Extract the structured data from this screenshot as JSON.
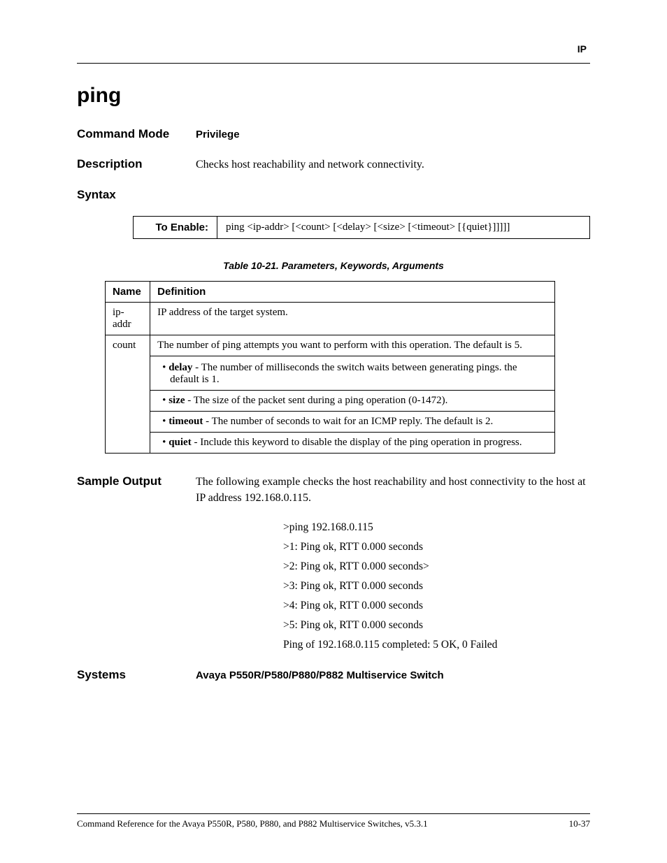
{
  "header": {
    "section": "IP"
  },
  "title": "ping",
  "sections": {
    "command_mode": {
      "label": "Command Mode",
      "value": "Privilege"
    },
    "description": {
      "label": "Description",
      "value": "Checks host reachability and network connectivity."
    },
    "syntax": {
      "label": "Syntax",
      "to_enable_label": "To Enable:",
      "to_enable_value": "ping <ip-addr> [<count> [<delay> [<size> [<timeout> [{quiet}]]]]]"
    },
    "sample_output": {
      "label": "Sample Output",
      "intro": "The following example checks the host reachability and host connectivity to the host at IP address 192.168.0.115.",
      "lines": [
        ">ping 192.168.0.115",
        ">1: Ping ok, RTT 0.000 seconds",
        ">2: Ping ok, RTT 0.000 seconds>",
        ">3: Ping ok, RTT 0.000 seconds",
        ">4: Ping ok, RTT 0.000 seconds",
        ">5: Ping ok, RTT 0.000 seconds",
        "Ping of 192.168.0.115 completed: 5 OK, 0 Failed"
      ]
    },
    "systems": {
      "label": "Systems",
      "value": "Avaya P550R/P580/P880/P882 Multiservice Switch"
    }
  },
  "params_table": {
    "caption": "Table 10-21.  Parameters, Keywords, Arguments",
    "headers": [
      "Name",
      "Definition"
    ],
    "rows": [
      {
        "name": "ip-addr",
        "definition": "IP address of the target system."
      },
      {
        "name": "count",
        "definition": "The number of ping attempts you want to perform with this operation. The default is 5.",
        "subitems": [
          {
            "term": "delay",
            "text": " - The number of milliseconds the switch waits between generating pings. the default is 1."
          },
          {
            "term": "size",
            "text": " - The size of the packet sent during a ping operation (0-1472)."
          },
          {
            "term": "timeout",
            "text": " - The number of seconds to wait for an ICMP reply.  The default is 2."
          },
          {
            "term": "quiet",
            "text": " - Include this keyword to disable the display of the ping operation in progress."
          }
        ]
      }
    ]
  },
  "footer": {
    "left": "Command Reference for the Avaya P550R, P580, P880, and P882 Multiservice Switches, v5.3.1",
    "right": "10-37"
  }
}
